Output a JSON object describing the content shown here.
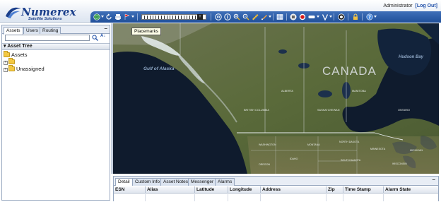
{
  "app": {
    "brand": "Numerex",
    "tagline": "Satellite Solutions",
    "user": "Administrator",
    "logout_label": "[Log Out]"
  },
  "toolbar": {
    "icons": [
      "globe-icon",
      "refresh-icon",
      "print-icon",
      "placemark-icon",
      "zoom-slider",
      "pan-icon",
      "info-icon",
      "zoom-in-icon",
      "zoom-out-icon",
      "ruler-icon",
      "draw-icon",
      "layers-icon",
      "stop-icon",
      "record-icon",
      "shape-icon",
      "filter-icon",
      "history-icon",
      "lock-icon",
      "help-icon"
    ],
    "zoom_minus": "−",
    "zoom_plus": "+"
  },
  "tooltip": "Placemarks",
  "left_panel": {
    "tabs": [
      "Assets",
      "Users",
      "Routing"
    ],
    "active_tab": "Assets",
    "collapse_label": "–",
    "search": {
      "value": "",
      "placeholder": ""
    },
    "sort_label": "A↓",
    "tree_header": "▾ Asset Tree",
    "tree": [
      {
        "label": "Assets",
        "level": 0
      },
      {
        "label": "",
        "level": 1
      },
      {
        "label": "Unassigned",
        "level": 1
      }
    ]
  },
  "map": {
    "labels": {
      "canada": "CANADA",
      "gulf": "Gulf of Alaska",
      "hudson": "Hudson Bay",
      "alberta": "ALBERTA",
      "manitoba": "MANITOBA",
      "saskatchewan": "SASKATCHEWAN",
      "bc": "BRITISH COLUMBIA",
      "ontario": "ONTARIO",
      "washington": "WASHINGTON",
      "montana": "MONTANA",
      "north_dakota": "NORTH DAKOTA",
      "minnesota": "MINNESOTA",
      "south_dakota": "SOUTH DAKOTA",
      "oregon": "OREGON",
      "idaho": "IDAHO",
      "wisconsin": "WISCONSIN",
      "michigan": "MICHIGAN"
    }
  },
  "bottom_panel": {
    "tabs": [
      "Detail",
      "Custom Info",
      "Asset Notes",
      "Messenger",
      "Alarms"
    ],
    "active_tab": "Detail",
    "collapse_label": "–",
    "columns": [
      "ESN",
      "Alias",
      "Latitude",
      "Longitude",
      "Address",
      "Zip",
      "Time Stamp",
      "Alarm State"
    ]
  },
  "colors": {
    "toolbar": "#2a5aa6",
    "brand": "#1b3f8b",
    "ocean": "#0e1a2e",
    "land": "#5e6b3c"
  }
}
